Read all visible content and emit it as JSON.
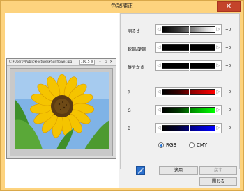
{
  "window": {
    "title": "色調補正",
    "close_glyph": "✕"
  },
  "image_window": {
    "path": "C:¥Users¥Public¥Pictures¥Sunflower.jpg",
    "zoom": "100.5 %",
    "buttons": [
      "–",
      "▫",
      "×"
    ]
  },
  "sliders": [
    {
      "label": "明るさ",
      "value": "+0",
      "colors": [
        "#000000",
        "#ffffff"
      ]
    },
    {
      "label": "軟調/硬調",
      "value": "+0",
      "colors": [
        "#000000",
        "#000000"
      ]
    },
    {
      "label": "鮮やかさ",
      "value": "+0",
      "colors": [
        "#000000",
        "#000000"
      ]
    },
    {
      "label": "R",
      "value": "+0",
      "colors": [
        "#000000",
        "#ff0000"
      ]
    },
    {
      "label": "G",
      "value": "+0",
      "colors": [
        "#000000",
        "#00ff00"
      ]
    },
    {
      "label": "B",
      "value": "+0",
      "colors": [
        "#000000",
        "#0000ff"
      ]
    }
  ],
  "arrows": {
    "left": "◁",
    "right": "▷"
  },
  "color_mode": {
    "options": [
      "RGB",
      "CMY"
    ],
    "selected": "RGB"
  },
  "buttons": {
    "apply": "適用",
    "undo": "戻す",
    "close": "閉じる"
  },
  "colors": {
    "titlebar": "#fdd37e",
    "close": "#c4442a",
    "sunflower": "#f5c400",
    "leaf": "#3f8f2a",
    "sky": "#7fb3e6"
  }
}
